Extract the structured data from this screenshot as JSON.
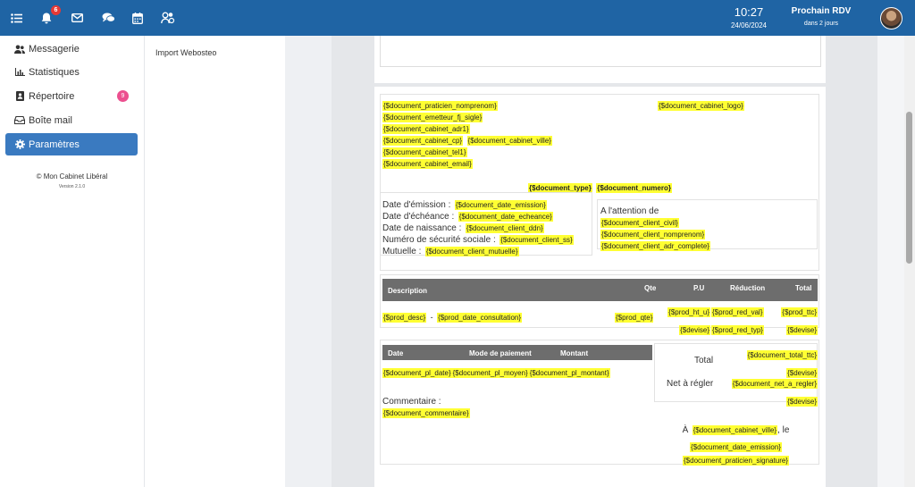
{
  "topbar": {
    "notif_count": "6",
    "time": "10:27",
    "date": "24/06/2024",
    "next_rdv_title": "Prochain RDV",
    "next_rdv_sub": "dans 2 jours",
    "accent": "#1f64a4"
  },
  "sidebar": {
    "items": [
      {
        "label": "Messagerie",
        "icon": "users-icon"
      },
      {
        "label": "Statistiques",
        "icon": "chart-icon"
      },
      {
        "label": "Répertoire",
        "icon": "address-book-icon",
        "badge": "9"
      },
      {
        "label": "Boîte mail",
        "icon": "inbox-icon"
      },
      {
        "label": "Paramètres",
        "icon": "gear-icon",
        "active": true
      }
    ],
    "copyright": "© Mon Cabinet Libéral",
    "version": "Version 2.1.0"
  },
  "subpanel": {
    "item": "Import Webosteo"
  },
  "doc": {
    "emitter": [
      "{$document_praticien_nomprenom}",
      "{$document_emetteur_fj_sigle}",
      "{$document_cabinet_adr1}",
      "{$document_cabinet_cp}",
      "{$document_cabinet_ville}",
      "{$document_cabinet_tel1}",
      "{$document_cabinet_email}"
    ],
    "logo": "{$document_cabinet_logo}",
    "type": "{$document_type}",
    "numero": "{$document_numero}",
    "date_emission_label": "Date d'émission :",
    "date_emission": "{$document_date_emission}",
    "date_echeance_label": "Date d'échéance :",
    "date_echeance": "{$document_date_echeance}",
    "ddn_label": "Date de naissance :",
    "ddn": "{$document_client_ddn}",
    "ss_label": "Numéro de sécurité sociale :",
    "ss": "{$document_client_ss}",
    "mutuelle_label": "Mutuelle :",
    "mutuelle": "{$document_client_mutuelle}",
    "attention_label": "A l'attention de",
    "client_civil": "{$document_client_civil}",
    "client_nomprenom": "{$document_client_nomprenom}",
    "client_adr": "{$document_client_adr_complete}",
    "products": {
      "headers": [
        "Description",
        "Qte",
        "P.U",
        "Réduction",
        "Total"
      ],
      "desc": "{$prod_desc}",
      "dash": "-",
      "date_consult": "{$prod_date_consultation}",
      "qte": "{$prod_qte}",
      "ht_u": "{$prod_ht_u}",
      "devise": "{$devise}",
      "red_val": "{$prod_red_val}",
      "red_typ": "{$prod_red_typ}",
      "ttc": "{$prod_ttc}"
    },
    "payments": {
      "headers": [
        "Date",
        "Mode de paiement",
        "Montant"
      ],
      "date": "{$document_pl_date}",
      "moyen": "{$document_pl_moyen}",
      "montant": "{$document_pl_montant}"
    },
    "total_label": "Total",
    "total_ttc": "{$document_total_ttc}",
    "net_label": "Net à régler",
    "net_a_regler": "{$document_net_a_regler}",
    "commentaire_label": "Commentaire :",
    "commentaire": "{$document_commentaire}",
    "a_label": "À",
    "cabinet_ville": "{$document_cabinet_ville}",
    "le_label": ", le",
    "signature": "{$document_praticien_signature}"
  }
}
